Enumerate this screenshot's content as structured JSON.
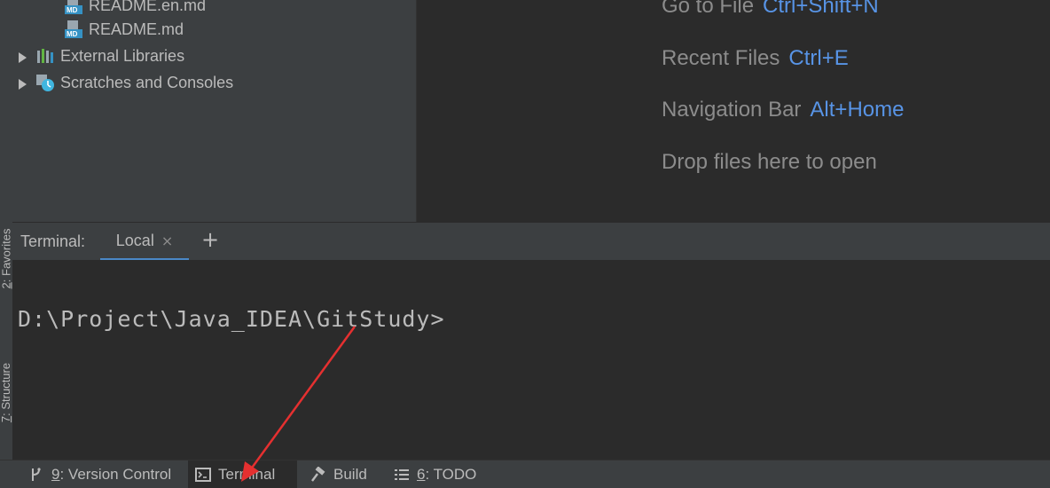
{
  "project_tree": {
    "items": [
      {
        "label": "README.en.md"
      },
      {
        "label": "README.md"
      },
      {
        "label": "External Libraries"
      },
      {
        "label": "Scratches and Consoles"
      }
    ]
  },
  "editor_hints": [
    {
      "text": "Go to File",
      "shortcut": "Ctrl+Shift+N"
    },
    {
      "text": "Recent Files",
      "shortcut": "Ctrl+E"
    },
    {
      "text": "Navigation Bar",
      "shortcut": "Alt+Home"
    },
    {
      "text": "Drop files here to open",
      "shortcut": ""
    }
  ],
  "left_strip": {
    "favorites": {
      "num": "2",
      "label": ": Favorites"
    },
    "structure": {
      "num": "7",
      "label": ": Structure"
    }
  },
  "terminal": {
    "title": "Terminal:",
    "tab_label": "Local",
    "close_symbol": "×",
    "add_symbol": "+",
    "prompt": "D:\\Project\\Java_IDEA\\GitStudy>"
  },
  "bottom_bar": {
    "tabs": [
      {
        "num": "9",
        "rest": ": Version Control"
      },
      {
        "num": "",
        "rest": "Terminal"
      },
      {
        "num": "",
        "rest": "Build"
      },
      {
        "num": "6",
        "rest": ": TODO"
      }
    ]
  },
  "colors": {
    "background": "#2b2b2b",
    "panel": "#3c3f41",
    "text": "#bbbbbb",
    "shortcut": "#5894e6",
    "active_tab_underline": "#4a88c7",
    "annotation_arrow": "#e53030"
  },
  "icons": {
    "markdown_file": "md-file-icon",
    "external_libraries": "library-icon",
    "scratches": "scratches-icon",
    "version_control": "branch-icon",
    "terminal": "terminal-icon",
    "build": "hammer-icon",
    "todo": "list-icon"
  }
}
